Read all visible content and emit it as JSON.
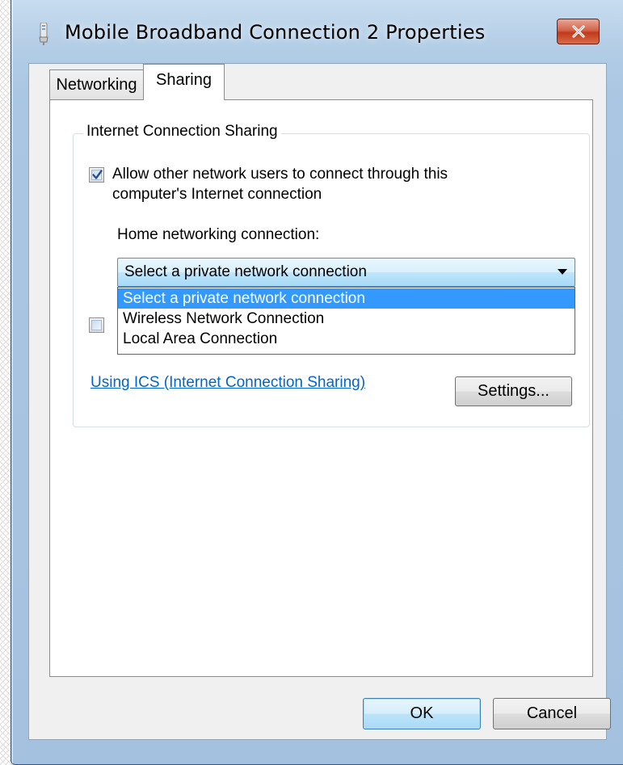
{
  "window": {
    "title": "Mobile Broadband Connection 2 Properties",
    "icon": "modem-icon",
    "close_icon": "close-icon"
  },
  "tabs": [
    {
      "label": "Networking",
      "selected": false
    },
    {
      "label": "Sharing",
      "selected": true
    }
  ],
  "sharing": {
    "group_title": "Internet Connection Sharing",
    "allow_checkbox": {
      "checked": true,
      "label_line1": "Allow other network users to connect through this",
      "label_line2": "computer's Internet connection"
    },
    "home_label": "Home networking connection:",
    "combo": {
      "selected_value": "Select a private network connection",
      "options": [
        "Select a private network connection",
        "Wireless Network Connection",
        "Local Area Connection"
      ],
      "highlighted_index": 0
    },
    "second_checkbox": {
      "checked": false
    },
    "help_link": "Using ICS (Internet Connection Sharing)",
    "settings_button": "Settings..."
  },
  "footer": {
    "ok_label": "OK",
    "cancel_label": "Cancel"
  },
  "colors": {
    "highlight": "#3399ff",
    "link": "#0066cc",
    "close_button": "#c2391b"
  }
}
